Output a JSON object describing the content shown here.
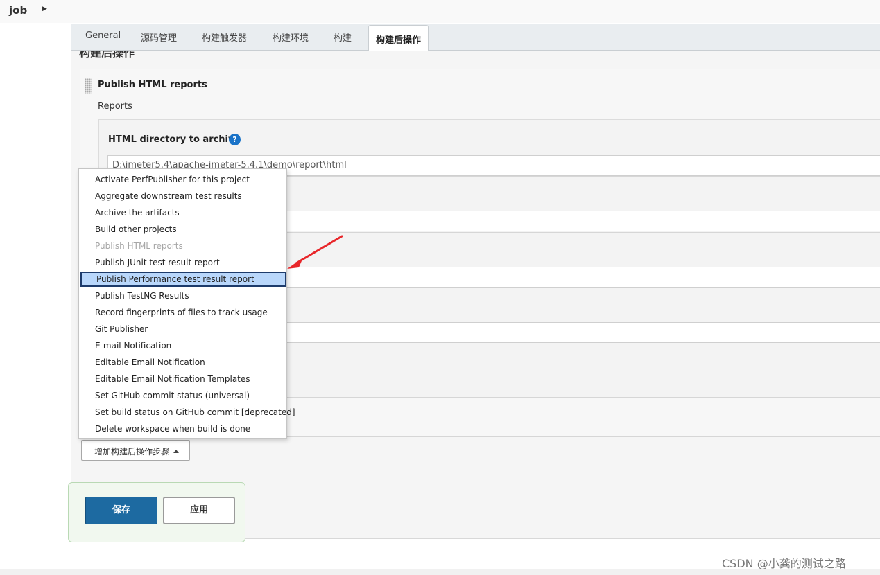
{
  "breadcrumb": {
    "job": "job"
  },
  "tabs": [
    "General",
    "源码管理",
    "构建触发器",
    "构建环境",
    "构建",
    "构建后操作"
  ],
  "active_tab": "构建后操作",
  "section_title": "构建后操作",
  "step": {
    "title": "Publish HTML reports",
    "reports_label": "Reports",
    "field_label": "HTML directory to archive",
    "help": "?",
    "html_directory_value": "D:\\jmeter5.4\\apache-jmeter-5.4.1\\demo\\report\\html"
  },
  "menu": {
    "items": [
      "Activate PerfPublisher for this project",
      "Aggregate downstream test results",
      "Archive the artifacts",
      "Build other projects",
      "Publish HTML reports",
      "Publish JUnit test result report",
      "Publish Performance test result report",
      "Publish TestNG Results",
      "Record fingerprints of files to track usage",
      "Git Publisher",
      "E-mail Notification",
      "Editable Email Notification",
      "Editable Email Notification Templates",
      "Set GitHub commit status (universal)",
      "Set build status on GitHub commit [deprecated]",
      "Delete workspace when build is done"
    ],
    "disabled_item": "Publish HTML reports",
    "selected_item": "Publish Performance test result report"
  },
  "add_step_button": "增加构建后操作步骤",
  "buttons": {
    "save": "保存",
    "apply": "应用"
  },
  "watermark": "CSDN @小龚的测试之路",
  "colors": {
    "primary": "#1d6aa1",
    "selection": "#b9d7fb",
    "annotation_arrow": "#e8262a",
    "help_icon": "#1a73c8"
  }
}
